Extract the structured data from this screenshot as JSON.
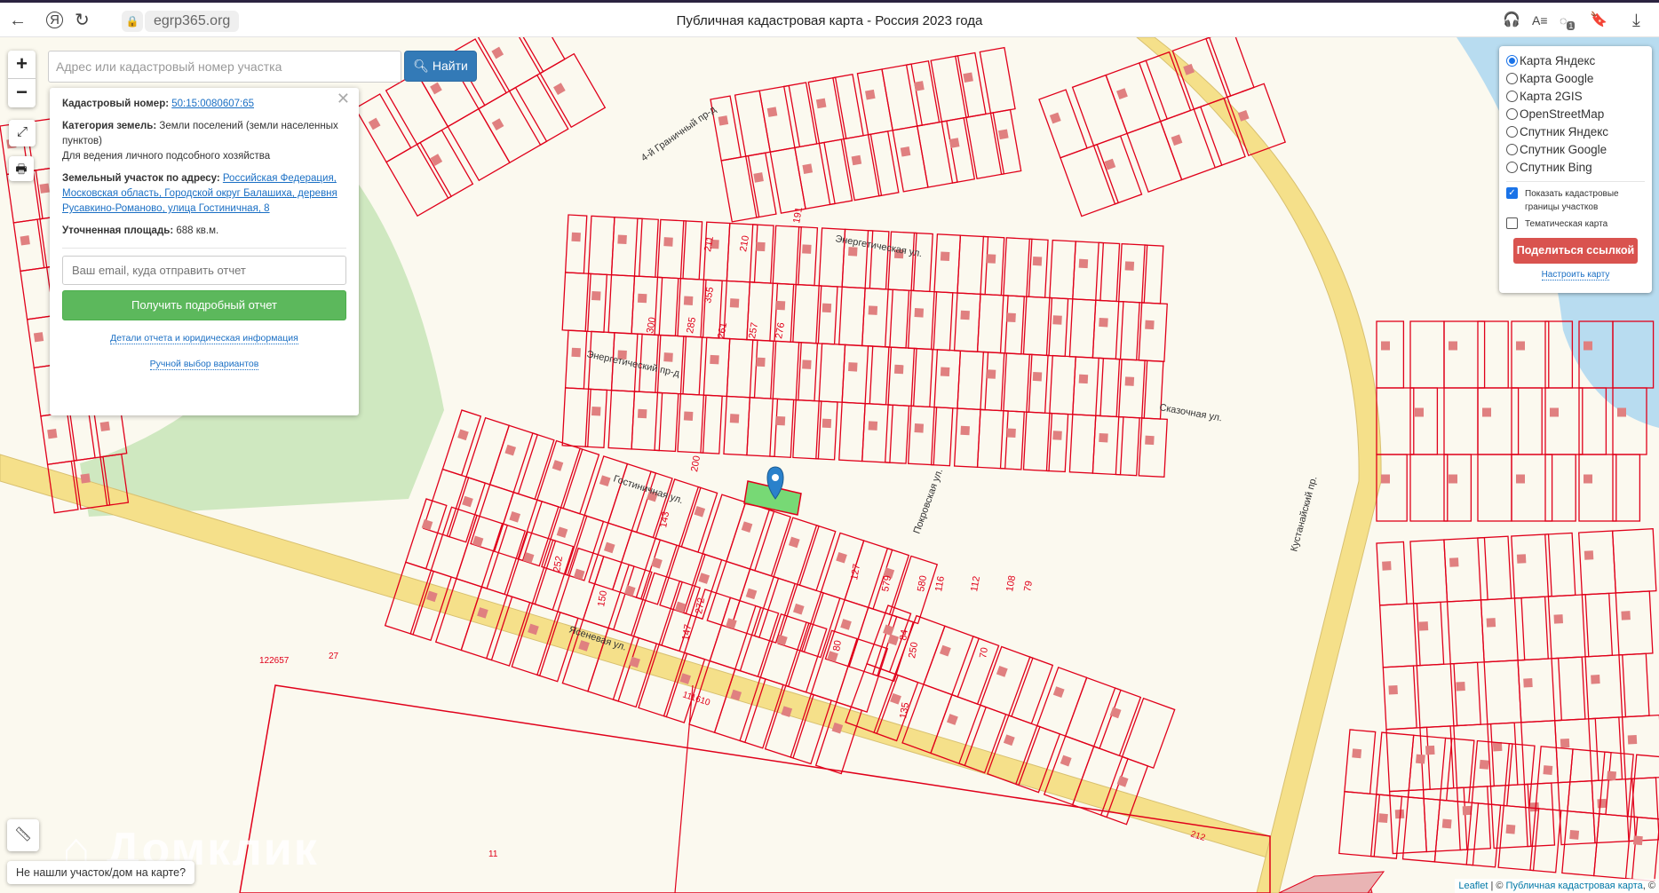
{
  "browser": {
    "url": "egrp365.org",
    "title": "Публичная кадастровая карта - Россия 2023 года",
    "tab_badge": "1"
  },
  "search": {
    "placeholder": "Адрес или кадастровый номер участка",
    "button": "Найти"
  },
  "zoom": {
    "in": "+",
    "out": "−"
  },
  "info": {
    "cad_label": "Кадастровый номер:",
    "cad_value": "50:15:0080607:65",
    "cat_label": "Категория земель:",
    "cat_value": "Земли поселений (земли населенных пунктов)",
    "use": "Для ведения личного подсобного хозяйства",
    "addr_label": "Земельный участок по адресу:",
    "addr_value": "Российская Федерация, Московская область, Городской округ Балашиха, деревня Русавкино-Романово, улица Гостиничная, 8",
    "area_label": "Уточненная площадь:",
    "area_value": "688 кв.м.",
    "email_placeholder": "Ваш email, куда отправить отчет",
    "get_report": "Получить подробный отчет",
    "details_link": "Детали отчета и юридическая информация",
    "manual_link": "Ручной выбор вариантов"
  },
  "layers": {
    "options": [
      "Карта Яндекс",
      "Карта Google",
      "Карта 2GIS",
      "OpenStreetMap",
      "Спутник Яндекс",
      "Спутник Google",
      "Спутник Bing"
    ],
    "selected": 0,
    "show_borders": "Показать кадастровые границы участков",
    "show_borders_checked": true,
    "thematic": "Тематическая карта",
    "thematic_checked": false,
    "share": "Поделиться ссылкой",
    "configure": "Настроить карту"
  },
  "map": {
    "streets": [
      "Энергетическая ул.",
      "Энергетический пр-д",
      "Гостиничная ул.",
      "Ясеневая ул.",
      "Сказочная ул.",
      "4-й Граничный пр-д",
      "Покровская ул.",
      "Кустанайский пр."
    ],
    "parcel_numbers": [
      "191",
      "211",
      "210",
      "355",
      "300",
      "285",
      "261",
      "257",
      "276",
      "200",
      "143",
      "252",
      "150",
      "127",
      "250",
      "579",
      "580",
      "116",
      "112",
      "108",
      "79",
      "70",
      "135",
      "84",
      "80",
      "272",
      "147"
    ],
    "area_numbers": [
      "122657",
      "111610",
      "212",
      "27",
      "11"
    ],
    "watermark": "Домклик",
    "colors": {
      "parcel": "#e0001a",
      "selected": "#5fd35f",
      "road": "#f5e08a",
      "park": "#cfe8c0",
      "water": "#b8dcf0"
    }
  },
  "not_found": "Не нашли участок/дом на карте?",
  "attribution": {
    "leaflet": "Leaflet",
    "sep": " | © ",
    "pkk": "Публичная кадастровая карта",
    "tail": ", ©"
  }
}
